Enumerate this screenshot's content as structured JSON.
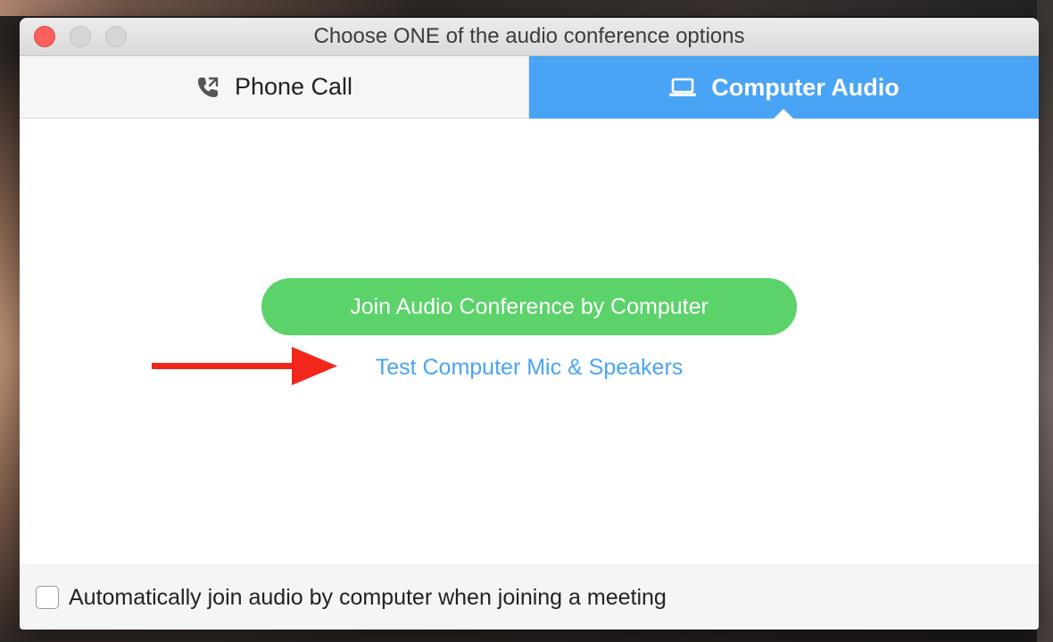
{
  "window": {
    "title": "Choose ONE of the audio conference options"
  },
  "tabs": [
    {
      "label": "Phone Call",
      "icon": "phone-icon",
      "selected": false
    },
    {
      "label": "Computer Audio",
      "icon": "laptop-icon",
      "selected": true
    }
  ],
  "main": {
    "join_button_label": "Join Audio Conference by Computer",
    "test_link_label": "Test Computer Mic & Speakers",
    "annotation": "red-arrow-icon"
  },
  "footer": {
    "checkbox_checked": false,
    "checkbox_label": "Automatically join audio by computer when joining a meeting"
  },
  "colors": {
    "accent_blue": "#4aa4f5",
    "join_green": "#5bd36a",
    "arrow_red": "#f2261b",
    "close_red": "#fc605c"
  }
}
